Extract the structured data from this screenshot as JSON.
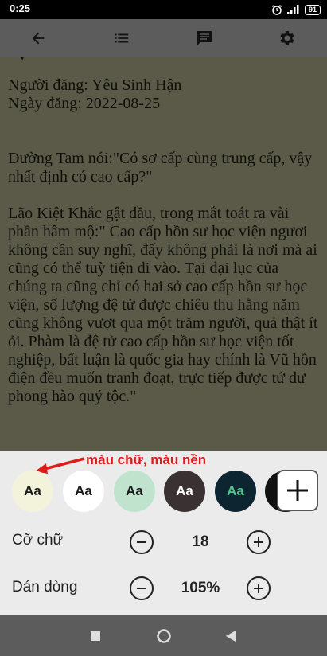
{
  "status_bar": {
    "time": "0:25",
    "battery": "91"
  },
  "toolbar": {
    "back": "back-arrow-icon",
    "toc": "list-icon",
    "comments": "comment-icon",
    "settings": "gear-icon"
  },
  "reader": {
    "author_line": "Người đăng: Yêu Sinh Hận",
    "date_line": "Ngày đăng: 2022-08-25",
    "paragraph1": "Đường Tam nói:\"Có sơ cấp cùng trung cấp, vậy nhất định có cao cấp?\"",
    "paragraph2": "Lão Kiệt Khắc gật đầu, trong mắt toát ra vài phần hâm mộ:\" Cao cấp hồn sư học viện ngươi không cần suy nghĩ, đấy không phải là nơi mà ai cũng có thể tuỳ tiện đi vào. Tại đại lục của chúng ta cũng chỉ có hai sở cao cấp hồn sư học viện, số lượng đệ tử được chiêu thu hằng năm cũng không vượt qua một trăm người, quả thật ít ỏi. Phàm là đệ tử cao cấp hồn sư học viện tốt nghiệp, bất luận là quốc gia hay chính là Vũ hồn điện đều muốn tranh đoạt, trực tiếp được tứ dư phong hào quý tộc.\""
  },
  "settings": {
    "annotation": "màu chữ, màu nền",
    "swatch_label": "Aa",
    "swatches": [
      {
        "bg": "#f3f3dc",
        "fg": "#1a1a1a"
      },
      {
        "bg": "#ffffff",
        "fg": "#1a1a1a"
      },
      {
        "bg": "#bfe3cc",
        "fg": "#1a1a1a"
      },
      {
        "bg": "#3a3232",
        "fg": "#ffffff"
      },
      {
        "bg": "#0d2530",
        "fg": "#4fc58a"
      }
    ],
    "font_size_label": "Cỡ chữ",
    "font_size_value": "18",
    "line_spacing_label": "Dán dòng",
    "line_spacing_value": "105%"
  },
  "nav": {
    "recent": "square-icon",
    "home": "circle-icon",
    "back": "triangle-icon"
  }
}
